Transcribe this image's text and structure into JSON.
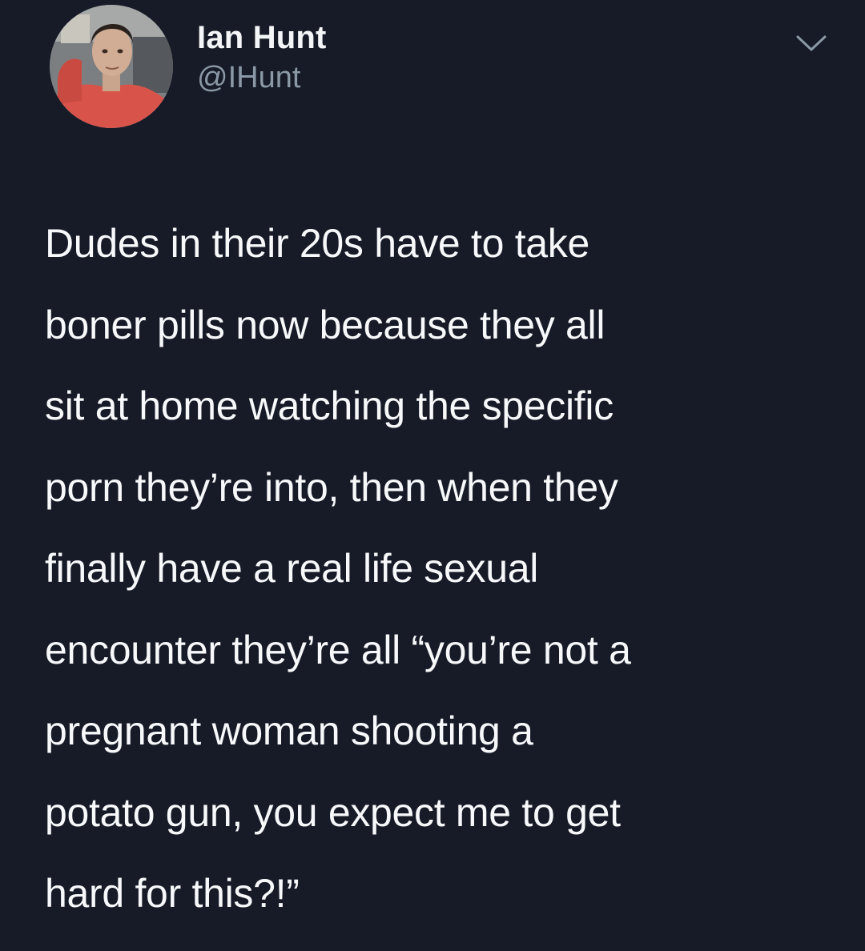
{
  "tweet": {
    "author": {
      "display_name": "Ian Hunt",
      "handle": "@IHunt",
      "avatar_icon": "profile-photo"
    },
    "menu_icon": "chevron-down-icon",
    "text": "Dudes in their 20s have to take\nboner pills now because they all\nsit at home watching the specific\nporn they’re into, then when they\nfinally have a real life sexual\nencounter they’re all “you’re not a\npregnant woman shooting a\npotato gun, you expect me to get\nhard for this?!”"
  },
  "colors": {
    "background": "#161b27",
    "text_primary": "#f4f5f7",
    "text_secondary": "#8b98a5"
  }
}
